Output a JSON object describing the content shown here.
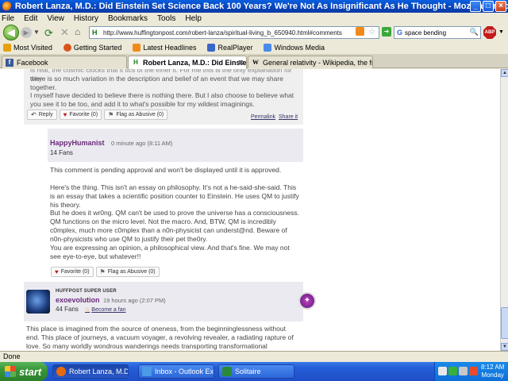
{
  "window": {
    "title": "Robert Lanza, M.D.: Did Einstein Set Science Back 100 Years? We're Not As Insignificant As He Thought - Mozilla Firefox",
    "buttons": {
      "minimize": "_",
      "maximize": "□",
      "close": "×"
    }
  },
  "menu": [
    "File",
    "Edit",
    "View",
    "History",
    "Bookmarks",
    "Tools",
    "Help"
  ],
  "nav": {
    "url": "http://www.huffingtonpost.com/robert-lanza/spiritual-living_b_650940.html#comments",
    "favicon": "H",
    "search_engine": "G",
    "search_value": "space bending",
    "adblock_label": "ABP"
  },
  "bookmarks": [
    {
      "label": "Most Visited",
      "icon": "star-folder-icon",
      "color": "#e8a010"
    },
    {
      "label": "Getting Started",
      "icon": "firefox-icon",
      "color": "#d9541a"
    },
    {
      "label": "Latest Headlines",
      "icon": "rss-icon",
      "color": "#f08a1a"
    },
    {
      "label": "RealPlayer",
      "icon": "realplayer-icon",
      "color": "#3a66c8"
    },
    {
      "label": "Windows Media",
      "icon": "windows-media-icon",
      "color": "#4a8ae8"
    }
  ],
  "tabs": [
    {
      "label": "Facebook",
      "icon": "f",
      "active": false
    },
    {
      "label": "Robert Lanza, M.D.: Did Einstein S...",
      "icon": "H",
      "active": true
    },
    {
      "label": "General relativity - Wikipedia, the free ...",
      "icon": "W",
      "active": false
    }
  ],
  "comment1": {
    "cut_line": "is real, the cosmic clocks that it tics of the inner it. For me this is the only explanation for why",
    "line2": "there is so much variation in the description and belief of an event that we may share together.",
    "para2": "I myself have decided to believe there is nothing there. But I also choose to believe what you see it to be too, and add it to what's possible for my wildest imaginings.",
    "reply": "Reply",
    "favorite": "Favorite (0)",
    "flag": "Flag as Abusive (0)",
    "permalink": "Permalink",
    "share": "Share it"
  },
  "comment2": {
    "name": "HappyHumanist",
    "time": "0 minute ago (8:11 AM)",
    "fans": "14 Fans",
    "pending": "This comment is pending approval and won't be displayed until it is approved.",
    "p1": "Here's the thing. This isn't an essay on philosophy. It's not a he-said-she-said. This is an essay that takes a scientific position counter to Einstein. He uses QM to justify his theory.",
    "p2": "But he does it wr0ng. QM can't be used to prove the universe has a consciousness. QM functions on the micro level. Not the macro. And, BTW, QM is incredibly c0mplex, much more c0mplex than a n0n-physicist can underst@nd. Beware of n0n-physicists who use QM to justify their pet the0ry.",
    "p3": "You are expressing an opinion, a philosophical view. And that's fine. We may not see eye-to-eye, but whatever!!",
    "favorite": "Favorite (0)",
    "flag": "Flag as Abusive (0)"
  },
  "comment3": {
    "badge_title": "HUFFPOST SUPER USER",
    "name": "exoevolution",
    "time": "19 hours ago (2:07 PM)",
    "fans": "44 Fans",
    "become_fan": "Become a fan",
    "text": "This place is imagined from the source of oneness, from the beginninglessness without end. This place of journeys, a vacuum voyager, a revolving revealer, a radiating rapture of love. So many worldly wondrous wanderings needs transporting transformational transcendence. Context color symbiotic"
  },
  "status": "Done",
  "taskbar": {
    "start": "start",
    "tasks": [
      {
        "label": "Robert Lanza, M.D.:...",
        "icon_color": "#e86a10",
        "active": true
      },
      {
        "label": "Inbox - Outlook Exp...",
        "icon_color": "#4a9ae8",
        "active": false
      },
      {
        "label": "Solitaire",
        "icon_color": "#2a8a3a",
        "active": false
      }
    ],
    "time": "8:12 AM",
    "day": "Monday"
  }
}
